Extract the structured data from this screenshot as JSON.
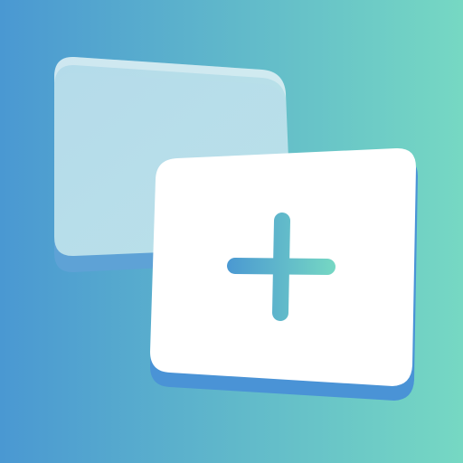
{
  "app_icon": {
    "icon_name": "add-card-icon",
    "colors": {
      "background_start": "#4a98d2",
      "background_end": "#76d8c3",
      "back_card": "#b9deeb",
      "back_card_shadow": "#5ea2d6",
      "front_card": "#ffffff",
      "front_card_shadow": "#4a93d6",
      "plus_start": "#4a98d2",
      "plus_end": "#76d8c3"
    }
  }
}
